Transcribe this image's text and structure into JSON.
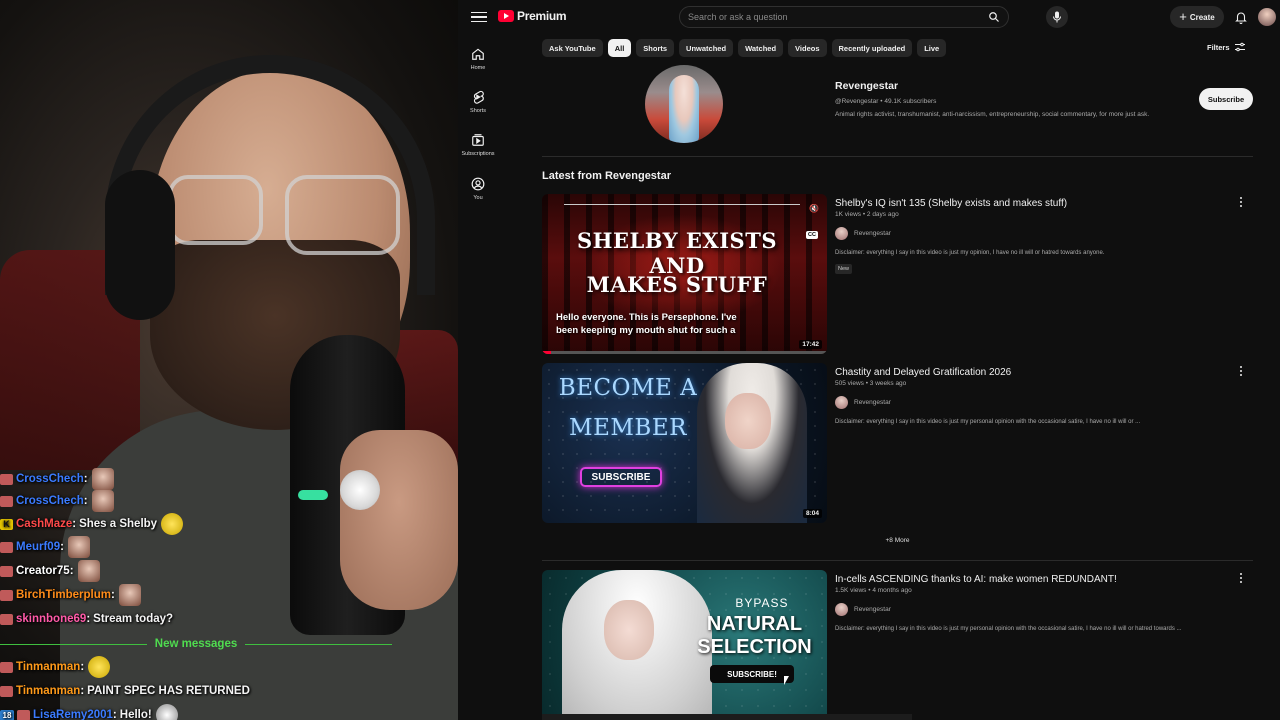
{
  "stream": {
    "chat": [
      {
        "user": "CrossChech",
        "color": "#3b7bff",
        "message": "",
        "emote": "face",
        "badge": "red"
      },
      {
        "user": "CrossChech",
        "color": "#3b7bff",
        "message": "",
        "emote": "face",
        "badge": "red"
      },
      {
        "user": "CashMaze",
        "color": "#ff4a4a",
        "message": "Shes a Shelby",
        "emote": "duck",
        "badge": "K"
      },
      {
        "user": "Meurf09",
        "color": "#3b7bff",
        "message": "",
        "emote": "face",
        "badge": "red"
      },
      {
        "user": "Creator75",
        "color": "#ffffff",
        "message": "",
        "emote": "face",
        "badge": "red"
      },
      {
        "user": "BirchTimberplum",
        "color": "#ff8c1a",
        "message": "",
        "emote": "face",
        "badge": "red"
      },
      {
        "user": "skinnbone69",
        "color": "#ff5aa8",
        "message": "Stream today?",
        "emote": "",
        "badge": "red"
      },
      {
        "user": "Tinmanman",
        "color": "#ff9a1a",
        "message": "",
        "emote": "duck",
        "badge": "red"
      },
      {
        "user": "Tinmanman",
        "color": "#ff9a1a",
        "message": "PAINT SPEC HAS RETURNED",
        "emote": "",
        "badge": "red"
      },
      {
        "user": "LisaRemy2001",
        "color": "#3b7bff",
        "message": "Hello!",
        "emote": "panda",
        "badge": "18"
      }
    ],
    "new_messages_label": "New messages"
  },
  "youtube": {
    "logo_text": "Premium",
    "search": {
      "placeholder": "Search or ask a question"
    },
    "create_label": "Create",
    "guide": [
      {
        "label": "Home",
        "icon": "home-icon"
      },
      {
        "label": "Shorts",
        "icon": "shorts-icon"
      },
      {
        "label": "Subscriptions",
        "icon": "subscriptions-icon"
      },
      {
        "label": "You",
        "icon": "you-icon"
      }
    ],
    "chips": [
      "Ask YouTube",
      "All",
      "Shorts",
      "Unwatched",
      "Watched",
      "Videos",
      "Recently uploaded",
      "Live"
    ],
    "active_chip": "All",
    "filters_label": "Filters",
    "channel": {
      "name": "Revengestar",
      "meta": "@Revengestar • 49.1K subscribers",
      "description": "Animal rights activist, transhumanist, anti-narcissism, entrepreneurship, social commentary, for more just ask.",
      "subscribe_label": "Subscribe"
    },
    "section_title": "Latest from Revengestar",
    "videos": [
      {
        "title": "Shelby's IQ isn't 135 (Shelby exists and makes stuff)",
        "meta": "1K views • 2 days ago",
        "author": "Revengestar",
        "description": "Disclaimer: everything I say in this video is just my opinion, I have no ill will or hatred towards anyone.",
        "badge": "New",
        "duration": "17:42",
        "thumb_lines": [
          "SHELBY EXISTS AND",
          "MAKES STUFF"
        ],
        "caption": "Hello everyone. This is Persephone. I've been keeping my mouth shut for such a",
        "progress": 0.03
      },
      {
        "title": "Chastity and Delayed Gratification 2026",
        "meta": "505 views • 3 weeks ago",
        "author": "Revengestar",
        "description": "Disclaimer: everything I say in this video is just my personal opinion with the occasional satire, I have no ill will or ...",
        "duration": "8:04",
        "thumb_lines": [
          "BECOME A",
          "MEMBER"
        ],
        "thumb_button": "SUBSCRIBE"
      },
      {
        "title": "In-cells ASCENDING thanks to AI: make women REDUNDANT!",
        "meta": "1.5K views • 4 months ago",
        "author": "Revengestar",
        "description": "Disclaimer: everything I say in this video is just my personal opinion with the occasional satire, I have no ill will or hatred towards ...",
        "thumb_lines": [
          "BYPASS",
          "NATURAL",
          "SELECTION"
        ],
        "thumb_button": "SUBSCRIBE!"
      }
    ],
    "more_label": "+8 More"
  }
}
